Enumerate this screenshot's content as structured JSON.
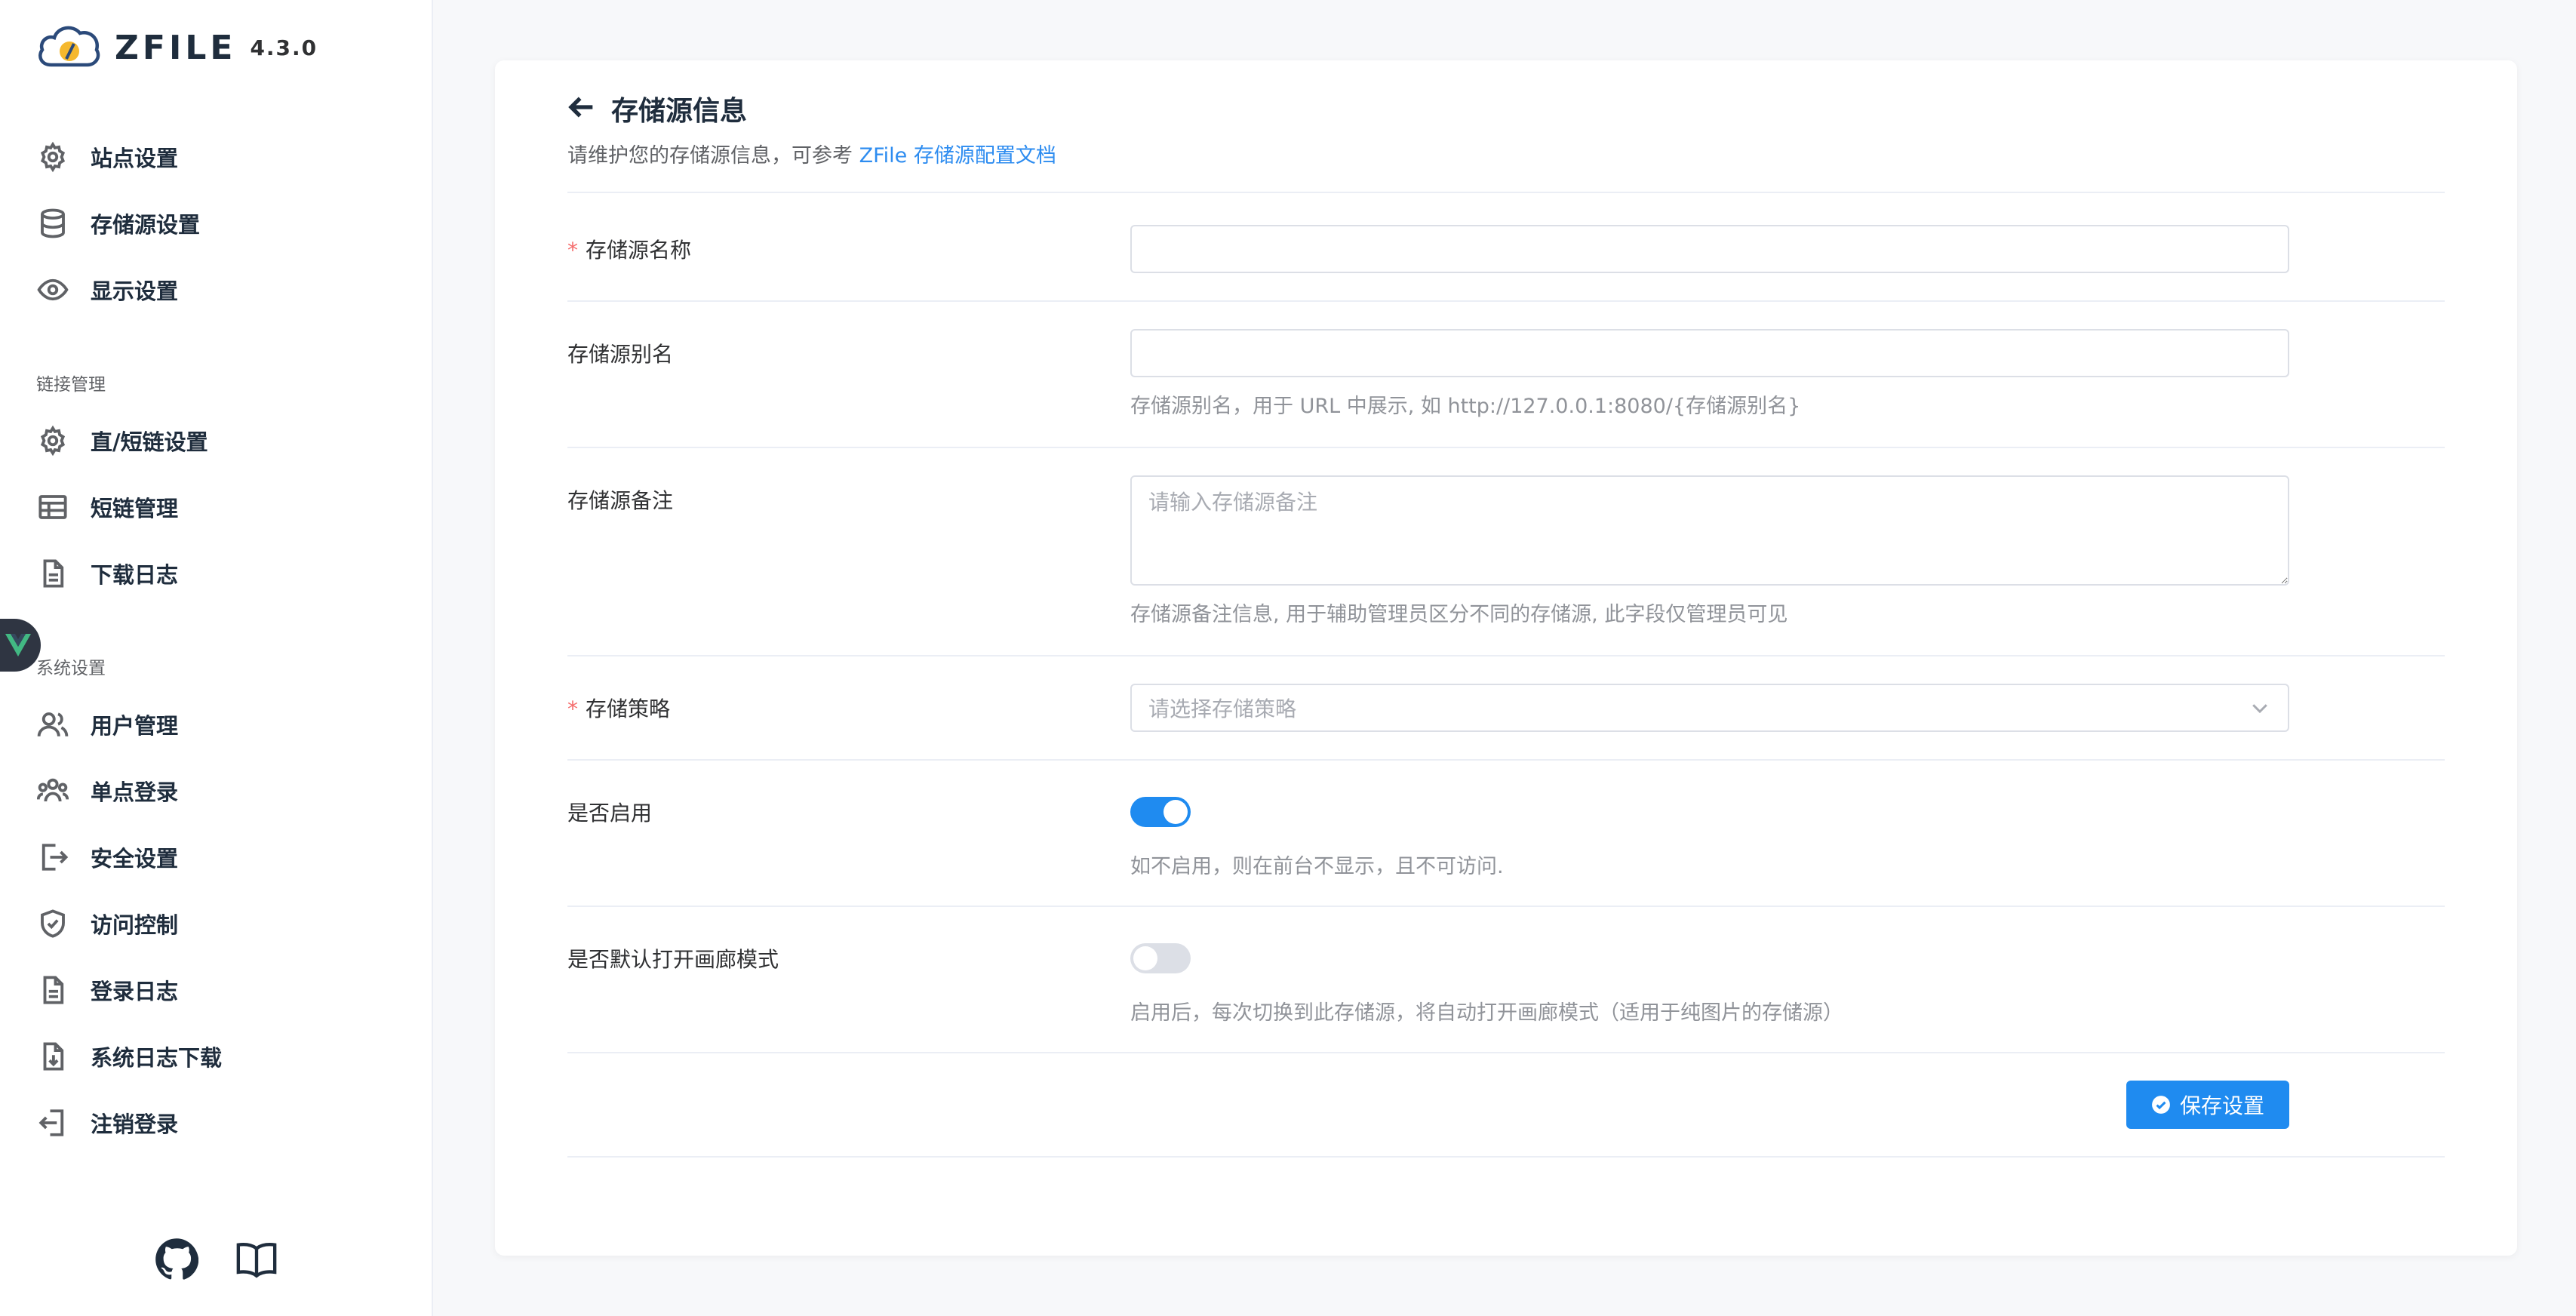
{
  "brand": {
    "name": "ZFILE",
    "version": "4.3.0"
  },
  "sidebar": {
    "items": [
      {
        "label": "站点设置",
        "icon": "gear-icon"
      },
      {
        "label": "存储源设置",
        "icon": "database-icon"
      },
      {
        "label": "显示设置",
        "icon": "eye-icon"
      }
    ],
    "link_group": {
      "title": "链接管理",
      "items": [
        {
          "label": "直/短链设置",
          "icon": "gear-icon"
        },
        {
          "label": "短链管理",
          "icon": "table-icon"
        },
        {
          "label": "下载日志",
          "icon": "document-icon"
        }
      ]
    },
    "system_group": {
      "title": "系统设置",
      "items": [
        {
          "label": "用户管理",
          "icon": "users-icon"
        },
        {
          "label": "单点登录",
          "icon": "group-icon"
        },
        {
          "label": "安全设置",
          "icon": "logout-icon"
        },
        {
          "label": "访问控制",
          "icon": "shield-check-icon"
        },
        {
          "label": "登录日志",
          "icon": "document-icon"
        },
        {
          "label": "系统日志下载",
          "icon": "download-document-icon"
        },
        {
          "label": "注销登录",
          "icon": "login-icon"
        }
      ]
    },
    "footer_icons": [
      "github-icon",
      "book-icon"
    ]
  },
  "page": {
    "title": "存储源信息",
    "subtitle_prefix": "请维护您的存储源信息，可参考 ",
    "subtitle_link": "ZFile 存储源配置文档"
  },
  "form": {
    "name": {
      "label": "存储源名称",
      "required": "*",
      "value": ""
    },
    "alias": {
      "label": "存储源别名",
      "value": "",
      "help": "存储源别名，用于 URL 中展示, 如 http://127.0.0.1:8080/{存储源别名}"
    },
    "remark": {
      "label": "存储源备注",
      "placeholder": "请输入存储源备注",
      "help": "存储源备注信息, 用于辅助管理员区分不同的存储源, 此字段仅管理员可见"
    },
    "strategy": {
      "label": "存储策略",
      "required": "*",
      "placeholder": "请选择存储策略"
    },
    "enable": {
      "label": "是否启用",
      "checked": true,
      "help": "如不启用，则在前台不显示，且不可访问."
    },
    "gallery": {
      "label": "是否默认打开画廊模式",
      "checked": false,
      "help": "启用后，每次切换到此存储源，将自动打开画廊模式（适用于纯图片的存储源）"
    },
    "save_label": "保存设置"
  },
  "colors": {
    "primary": "#1f8bf0",
    "required": "#f56c6c",
    "link": "#2d8cf0"
  }
}
